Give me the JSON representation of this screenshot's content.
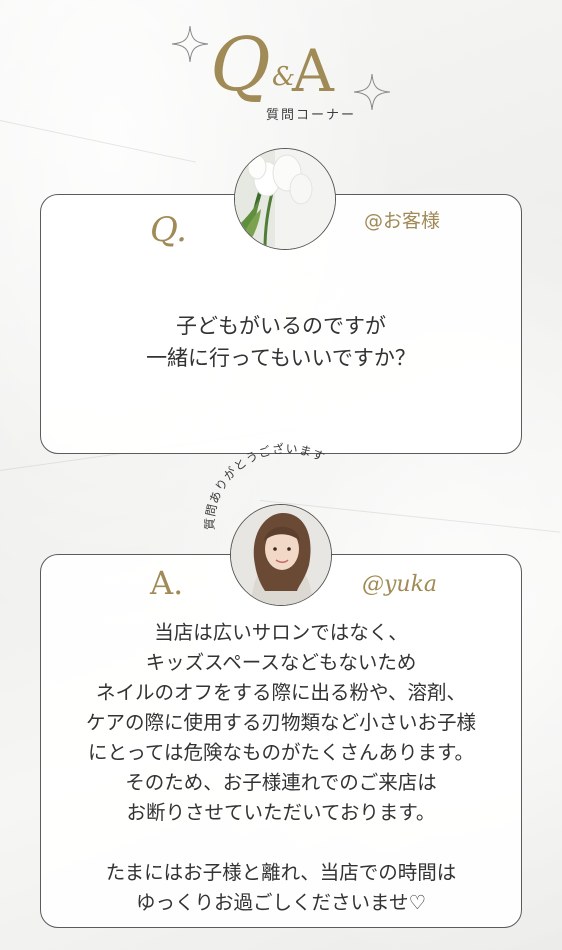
{
  "header": {
    "q_letter": "Q",
    "ampersand": "&",
    "a_letter": "A",
    "subtitle": "質問コーナー"
  },
  "question_card": {
    "letter": "Q.",
    "handle": "@お客様",
    "lines": [
      "子どもがいるのですが",
      "一緒に行ってもいいですか？"
    ]
  },
  "answer_card": {
    "arc_label": "質問ありがとうございます",
    "letter": "A.",
    "handle": "@yuka",
    "lines": [
      "当店は広いサロンではなく、",
      "キッズスペースなどもないため",
      "ネイルのオフをする際に出る粉や、溶剤、",
      "ケアの際に使用する刃物類など小さいお子様",
      "にとっては危険なものがたくさんあります。",
      "そのため、お子様連れでのご来店は",
      "お断りさせていただいております。",
      "たまにはお子様と離れ、当店での時間は",
      "ゆっくりお過ごしくださいませ♡"
    ]
  },
  "colors": {
    "accent_gold": "#a08a56",
    "border": "#5b5b5b",
    "text": "#333333"
  }
}
